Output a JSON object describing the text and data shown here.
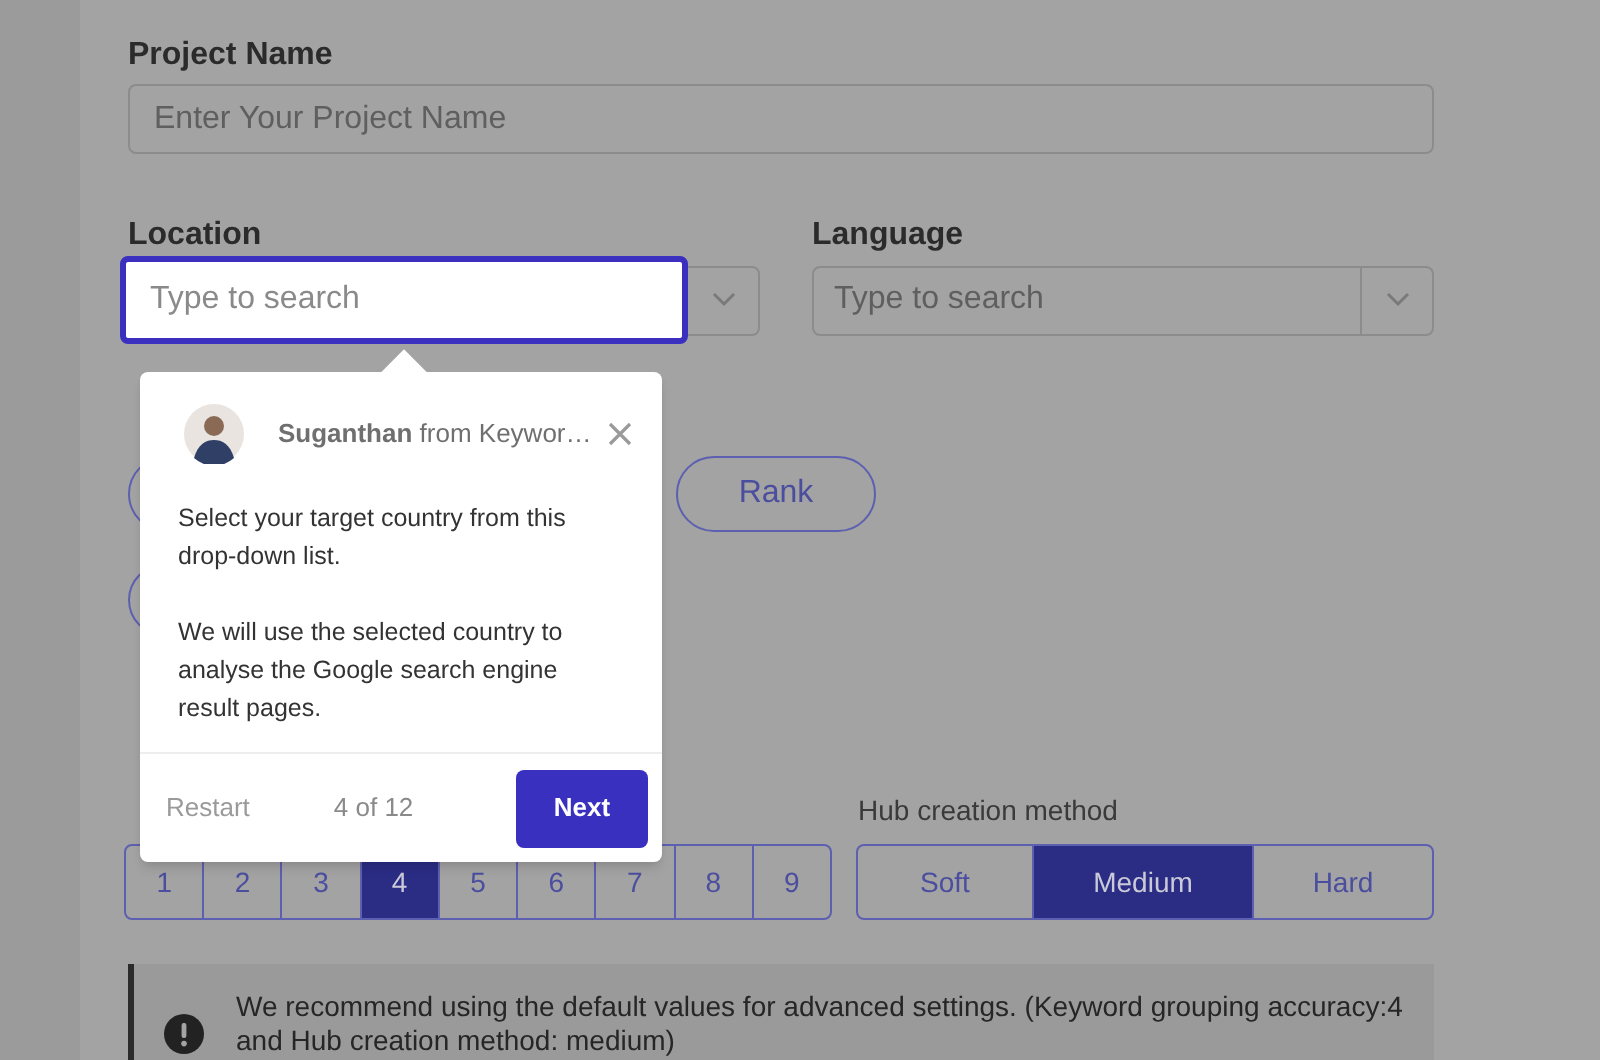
{
  "form": {
    "project_name": {
      "label": "Project Name",
      "placeholder": "Enter Your Project Name"
    },
    "location": {
      "label": "Location",
      "placeholder": "Type to search",
      "focused": true
    },
    "language": {
      "label": "Language",
      "placeholder": "Type to search",
      "focused": false
    },
    "pills": [
      {
        "label": "Rank"
      }
    ],
    "accuracy_options": [
      {
        "label": "1",
        "selected": false
      },
      {
        "label": "2",
        "selected": false
      },
      {
        "label": "3",
        "selected": false
      },
      {
        "label": "4",
        "selected": true
      },
      {
        "label": "5",
        "selected": false
      },
      {
        "label": "6",
        "selected": false
      },
      {
        "label": "7",
        "selected": false
      },
      {
        "label": "8",
        "selected": false
      },
      {
        "label": "9",
        "selected": false
      }
    ],
    "hub_method": {
      "label": "Hub creation method",
      "options": [
        {
          "label": "Soft",
          "selected": false
        },
        {
          "label": "Medium",
          "selected": true
        },
        {
          "label": "Hard",
          "selected": false
        }
      ]
    },
    "alert": {
      "text": "We recommend using the default values for advanced settings. (Keyword grouping accuracy:4 and Hub creation method: medium)"
    }
  },
  "tour": {
    "author": "Suganthan",
    "org": "from Keywor…",
    "paragraphs": [
      "Select your target country from this drop-down list.",
      "We will use the selected country to analyse the Google search engine result pages."
    ],
    "restart": "Restart",
    "progress": "4 of 12",
    "next": "Next"
  }
}
